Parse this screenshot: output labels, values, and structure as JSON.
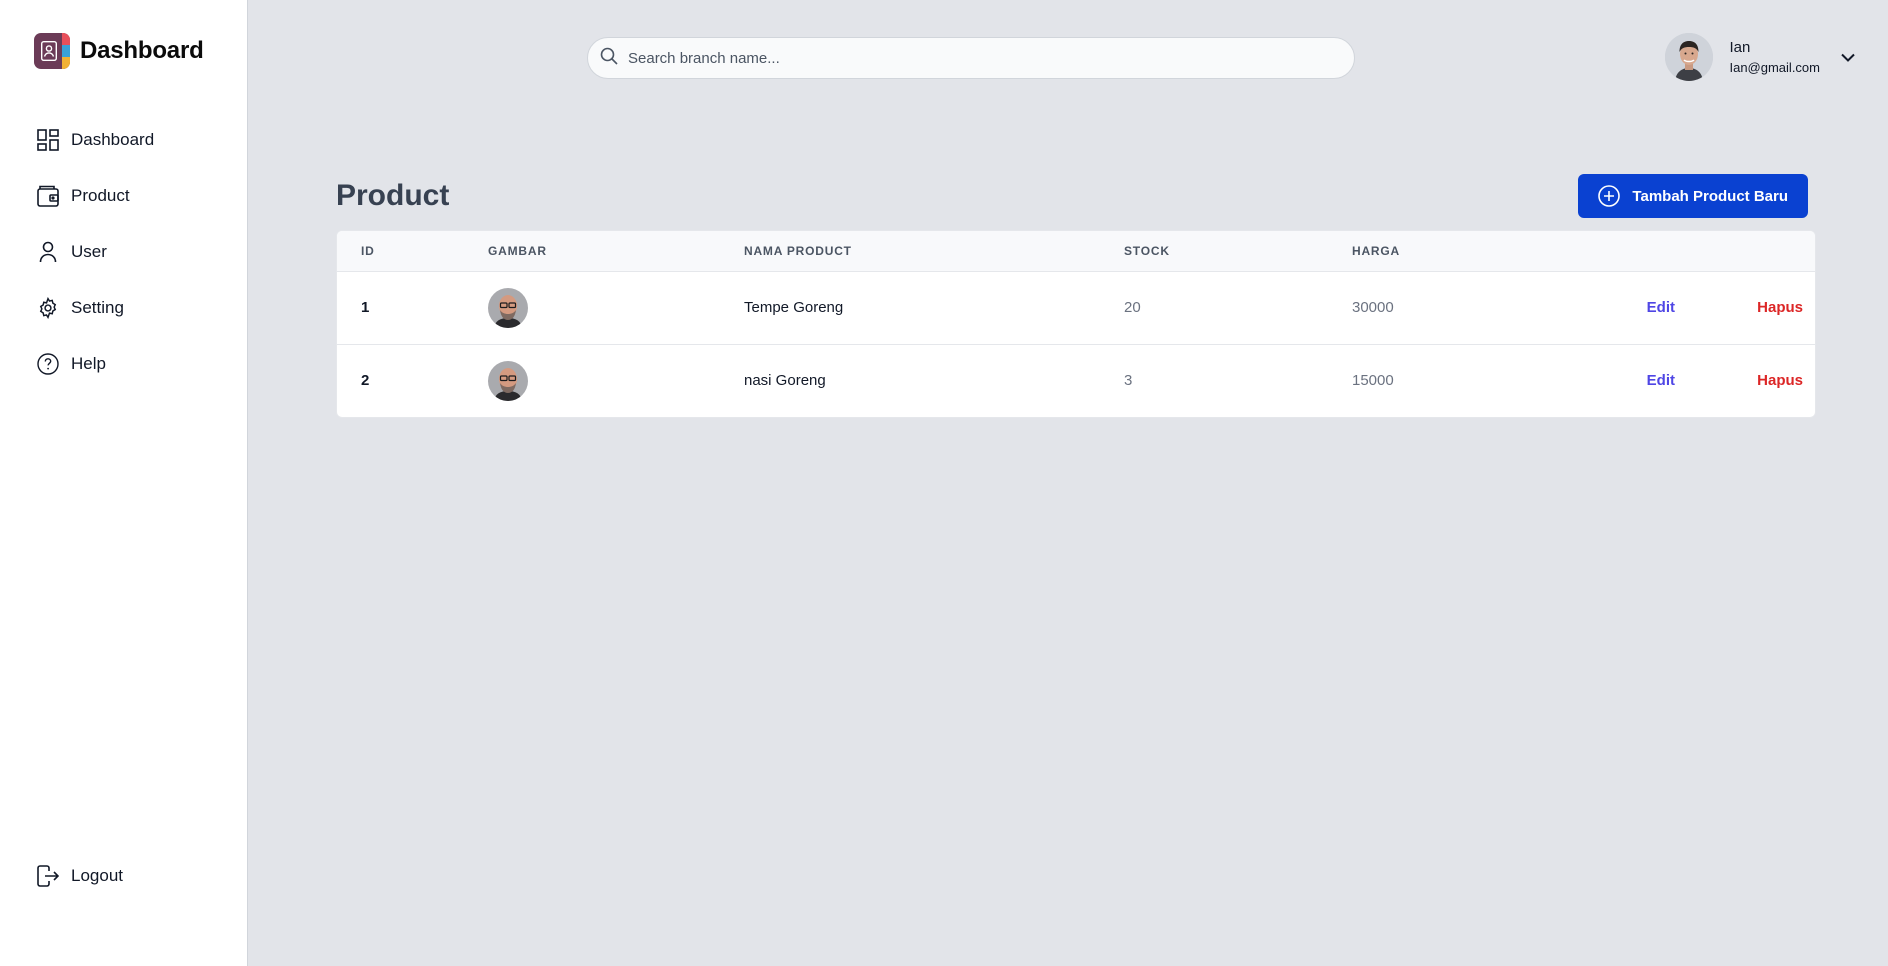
{
  "sidebar": {
    "brand_title": "Dashboard",
    "items": [
      {
        "label": "Dashboard",
        "icon": "grid-icon"
      },
      {
        "label": "Product",
        "icon": "wallet-icon"
      },
      {
        "label": "User",
        "icon": "user-icon"
      },
      {
        "label": "Setting",
        "icon": "gear-icon"
      },
      {
        "label": "Help",
        "icon": "help-circle-icon"
      }
    ],
    "logout_label": "Logout"
  },
  "search": {
    "placeholder": "Search branch name..."
  },
  "profile": {
    "name": "Ian",
    "email": "Ian@gmail.com"
  },
  "page": {
    "title": "Product",
    "add_button_label": "Tambah Product Baru"
  },
  "table": {
    "headers": [
      "ID",
      "GAMBAR",
      "NAMA PRODUCT",
      "STOCK",
      "HARGA"
    ],
    "rows": [
      {
        "id": "1",
        "name": "Tempe Goreng",
        "stock": "20",
        "harga": "30000",
        "edit": "Edit",
        "hapus": "Hapus"
      },
      {
        "id": "2",
        "name": "nasi Goreng",
        "stock": "3",
        "harga": "15000",
        "edit": "Edit",
        "hapus": "Hapus"
      }
    ]
  },
  "colors": {
    "primary": "#0a41d1",
    "edit": "#4f46e5",
    "delete": "#dc2626",
    "background": "#e2e4e9"
  }
}
